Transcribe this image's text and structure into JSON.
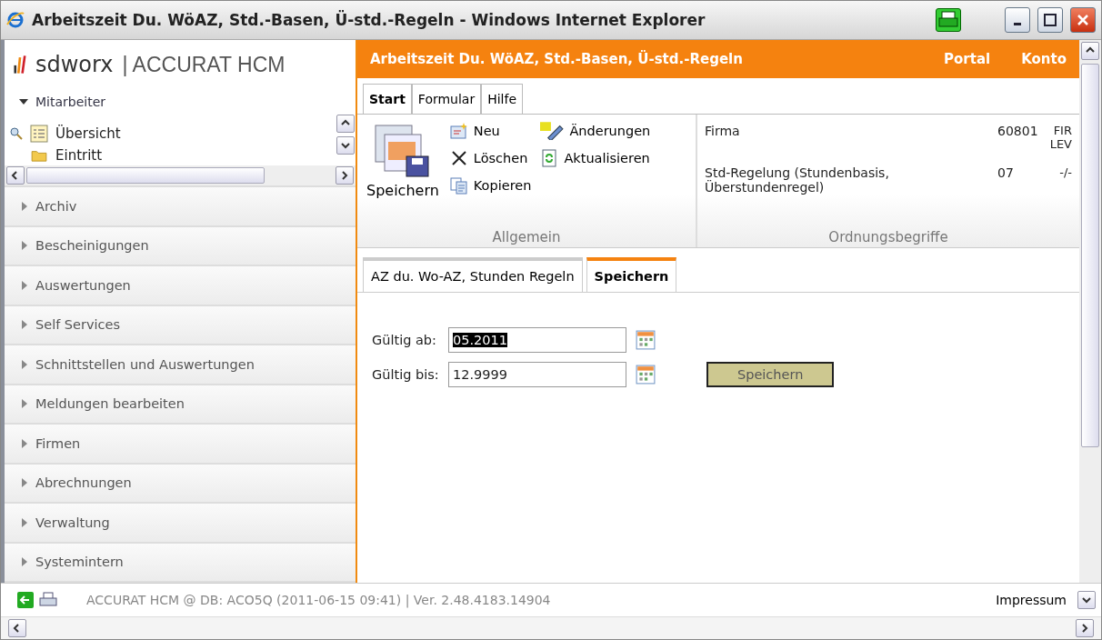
{
  "window": {
    "title": "Arbeitszeit Du. WöAZ, Std.-Basen, Ü-std.-Regeln - Windows Internet Explorer"
  },
  "logo": {
    "brand": "sdworx",
    "product": "| ACCURAT HCM"
  },
  "header": {
    "title": "Arbeitszeit Du. WöAZ, Std.-Basen, Ü-std.-Regeln",
    "links": [
      "Portal",
      "Konto"
    ]
  },
  "sidebar": {
    "section": {
      "label": "Mitarbeiter",
      "expanded": true
    },
    "tree": [
      {
        "label": "Übersicht",
        "kind": "overview"
      },
      {
        "label": "Eintritt",
        "kind": "folder"
      }
    ],
    "items": [
      {
        "label": "Archiv",
        "expanded": false
      },
      {
        "label": "Bescheinigungen",
        "expanded": false
      },
      {
        "label": "Auswertungen",
        "expanded": false
      },
      {
        "label": "Self Services",
        "expanded": false
      },
      {
        "label": "Schnittstellen und Auswertungen",
        "expanded": false
      },
      {
        "label": "Meldungen bearbeiten",
        "expanded": false
      },
      {
        "label": "Firmen",
        "expanded": false
      },
      {
        "label": "Abrechnungen",
        "expanded": false
      },
      {
        "label": "Verwaltung",
        "expanded": false
      },
      {
        "label": "Systemintern",
        "expanded": false
      }
    ]
  },
  "ribbon_tabs": [
    {
      "label": "Start",
      "selected": true
    },
    {
      "label": "Formular",
      "selected": false
    },
    {
      "label": "Hilfe",
      "selected": false
    }
  ],
  "ribbon": {
    "save": "Speichern",
    "actions": [
      {
        "label": "Neu",
        "kind": "new"
      },
      {
        "label": "Änderungen",
        "kind": "changes"
      },
      {
        "label": "Löschen",
        "kind": "delete"
      },
      {
        "label": "Aktualisieren",
        "kind": "refresh"
      },
      {
        "label": "Kopieren",
        "kind": "copy"
      }
    ],
    "group_1": "Allgemein",
    "keys": [
      {
        "label": "Firma",
        "code": "60801",
        "value": [
          "FIR",
          "LEV"
        ]
      },
      {
        "label": "Std-Regelung (Stundenbasis, Überstundenregel)",
        "code": "07",
        "value": [
          "-/-"
        ]
      }
    ],
    "group_2": "Ordnungsbegriffe"
  },
  "form_tabs": [
    {
      "label": "AZ du. Wo-AZ, Stunden Regeln",
      "selected": false
    },
    {
      "label": "Speichern",
      "selected": true
    }
  ],
  "form": {
    "fields": [
      {
        "label": "Gültig ab:",
        "value": "05.2011",
        "text_selected": true
      },
      {
        "label": "Gültig bis:",
        "value": "12.9999",
        "text_selected": false
      }
    ],
    "button": "Speichern"
  },
  "status_bar": {
    "text": "ACCURAT HCM @ DB: ACO5Q (2011-06-15 09:41) | Ver. 2.48.4183.14904",
    "link": "Impressum"
  }
}
